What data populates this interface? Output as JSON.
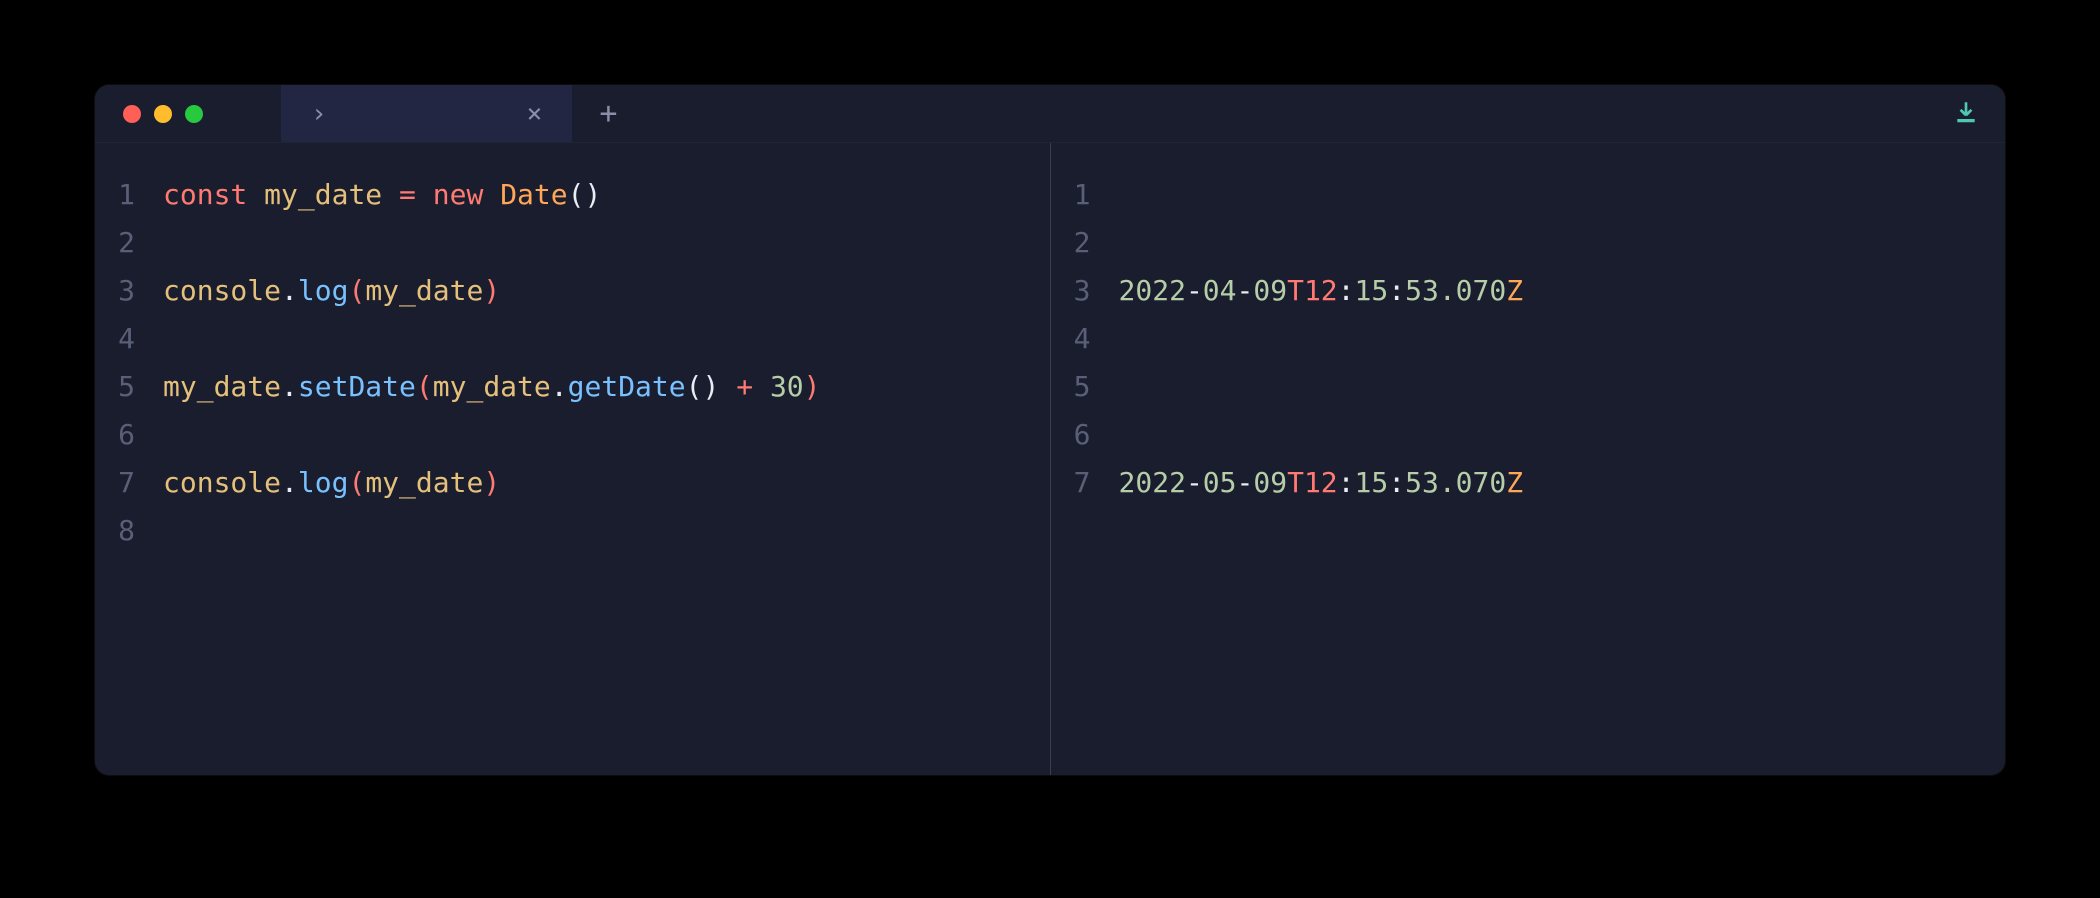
{
  "tab": {
    "title": "›",
    "close": "×",
    "add": "+"
  },
  "leftPane": {
    "lines": [
      {
        "n": "1",
        "tokens": [
          {
            "cls": "tk-keyword",
            "t": "const"
          },
          {
            "cls": "tk-plain",
            "t": " "
          },
          {
            "cls": "tk-ident",
            "t": "my_date"
          },
          {
            "cls": "tk-plain",
            "t": " "
          },
          {
            "cls": "tk-keyword",
            "t": "="
          },
          {
            "cls": "tk-plain",
            "t": " "
          },
          {
            "cls": "tk-keyword",
            "t": "new"
          },
          {
            "cls": "tk-plain",
            "t": " "
          },
          {
            "cls": "tk-class",
            "t": "Date"
          },
          {
            "cls": "tk-white",
            "t": "()"
          }
        ]
      },
      {
        "n": "2",
        "tokens": []
      },
      {
        "n": "3",
        "tokens": [
          {
            "cls": "tk-ident",
            "t": "console"
          },
          {
            "cls": "tk-white",
            "t": "."
          },
          {
            "cls": "tk-func",
            "t": "log"
          },
          {
            "cls": "tk-paren",
            "t": "("
          },
          {
            "cls": "tk-ident",
            "t": "my_date"
          },
          {
            "cls": "tk-paren",
            "t": ")"
          }
        ]
      },
      {
        "n": "4",
        "tokens": []
      },
      {
        "n": "5",
        "tokens": [
          {
            "cls": "tk-ident",
            "t": "my_date"
          },
          {
            "cls": "tk-white",
            "t": "."
          },
          {
            "cls": "tk-func",
            "t": "setDate"
          },
          {
            "cls": "tk-paren",
            "t": "("
          },
          {
            "cls": "tk-ident",
            "t": "my_date"
          },
          {
            "cls": "tk-white",
            "t": "."
          },
          {
            "cls": "tk-func",
            "t": "getDate"
          },
          {
            "cls": "tk-white",
            "t": "()"
          },
          {
            "cls": "tk-white",
            "t": " "
          },
          {
            "cls": "tk-keyword",
            "t": "+"
          },
          {
            "cls": "tk-white",
            "t": " "
          },
          {
            "cls": "tk-number",
            "t": "30"
          },
          {
            "cls": "tk-paren",
            "t": ")"
          }
        ]
      },
      {
        "n": "6",
        "tokens": []
      },
      {
        "n": "7",
        "tokens": [
          {
            "cls": "tk-ident",
            "t": "console"
          },
          {
            "cls": "tk-white",
            "t": "."
          },
          {
            "cls": "tk-func",
            "t": "log"
          },
          {
            "cls": "tk-paren",
            "t": "("
          },
          {
            "cls": "tk-ident",
            "t": "my_date"
          },
          {
            "cls": "tk-paren",
            "t": ")"
          }
        ]
      },
      {
        "n": "8",
        "tokens": []
      }
    ]
  },
  "rightPane": {
    "lines": [
      {
        "n": "1",
        "tokens": []
      },
      {
        "n": "2",
        "tokens": []
      },
      {
        "n": "3",
        "tokens": [
          {
            "cls": "tk-datenum",
            "t": "2022"
          },
          {
            "cls": "tk-white",
            "t": "-"
          },
          {
            "cls": "tk-datenum",
            "t": "04"
          },
          {
            "cls": "tk-white",
            "t": "-"
          },
          {
            "cls": "tk-datenum",
            "t": "09"
          },
          {
            "cls": "tk-dateT",
            "t": "T12"
          },
          {
            "cls": "tk-white",
            "t": ":"
          },
          {
            "cls": "tk-datenum",
            "t": "15"
          },
          {
            "cls": "tk-white",
            "t": ":"
          },
          {
            "cls": "tk-datenum",
            "t": "53.070"
          },
          {
            "cls": "tk-dateZ",
            "t": "Z"
          }
        ]
      },
      {
        "n": "4",
        "tokens": []
      },
      {
        "n": "5",
        "tokens": []
      },
      {
        "n": "6",
        "tokens": []
      },
      {
        "n": "7",
        "tokens": [
          {
            "cls": "tk-datenum",
            "t": "2022"
          },
          {
            "cls": "tk-white",
            "t": "-"
          },
          {
            "cls": "tk-datenum",
            "t": "05"
          },
          {
            "cls": "tk-white",
            "t": "-"
          },
          {
            "cls": "tk-datenum",
            "t": "09"
          },
          {
            "cls": "tk-dateT",
            "t": "T12"
          },
          {
            "cls": "tk-white",
            "t": ":"
          },
          {
            "cls": "tk-datenum",
            "t": "15"
          },
          {
            "cls": "tk-white",
            "t": ":"
          },
          {
            "cls": "tk-datenum",
            "t": "53.070"
          },
          {
            "cls": "tk-dateZ",
            "t": "Z"
          }
        ]
      }
    ]
  }
}
